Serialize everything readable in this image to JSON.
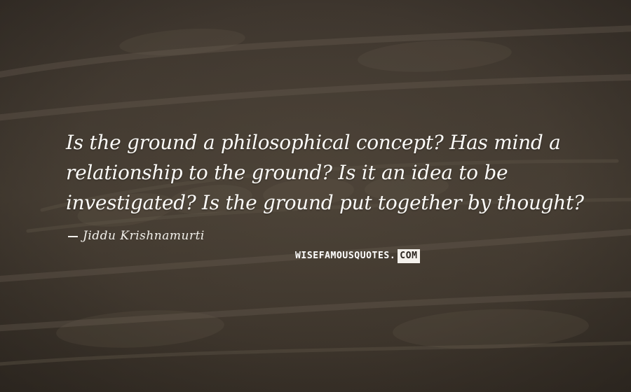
{
  "quote": {
    "text": "Is the ground a philosophical concept? Has mind a relationship to the ground? Is it an idea to be investigated? Is the ground put together by thought?",
    "author": "Jiddu Krishnamurti"
  },
  "watermark": {
    "main": "WISEFAMOUSQUOTES.",
    "suffix": "COM"
  },
  "colors": {
    "background": "#3d352d",
    "text": "#fbfaf7"
  }
}
